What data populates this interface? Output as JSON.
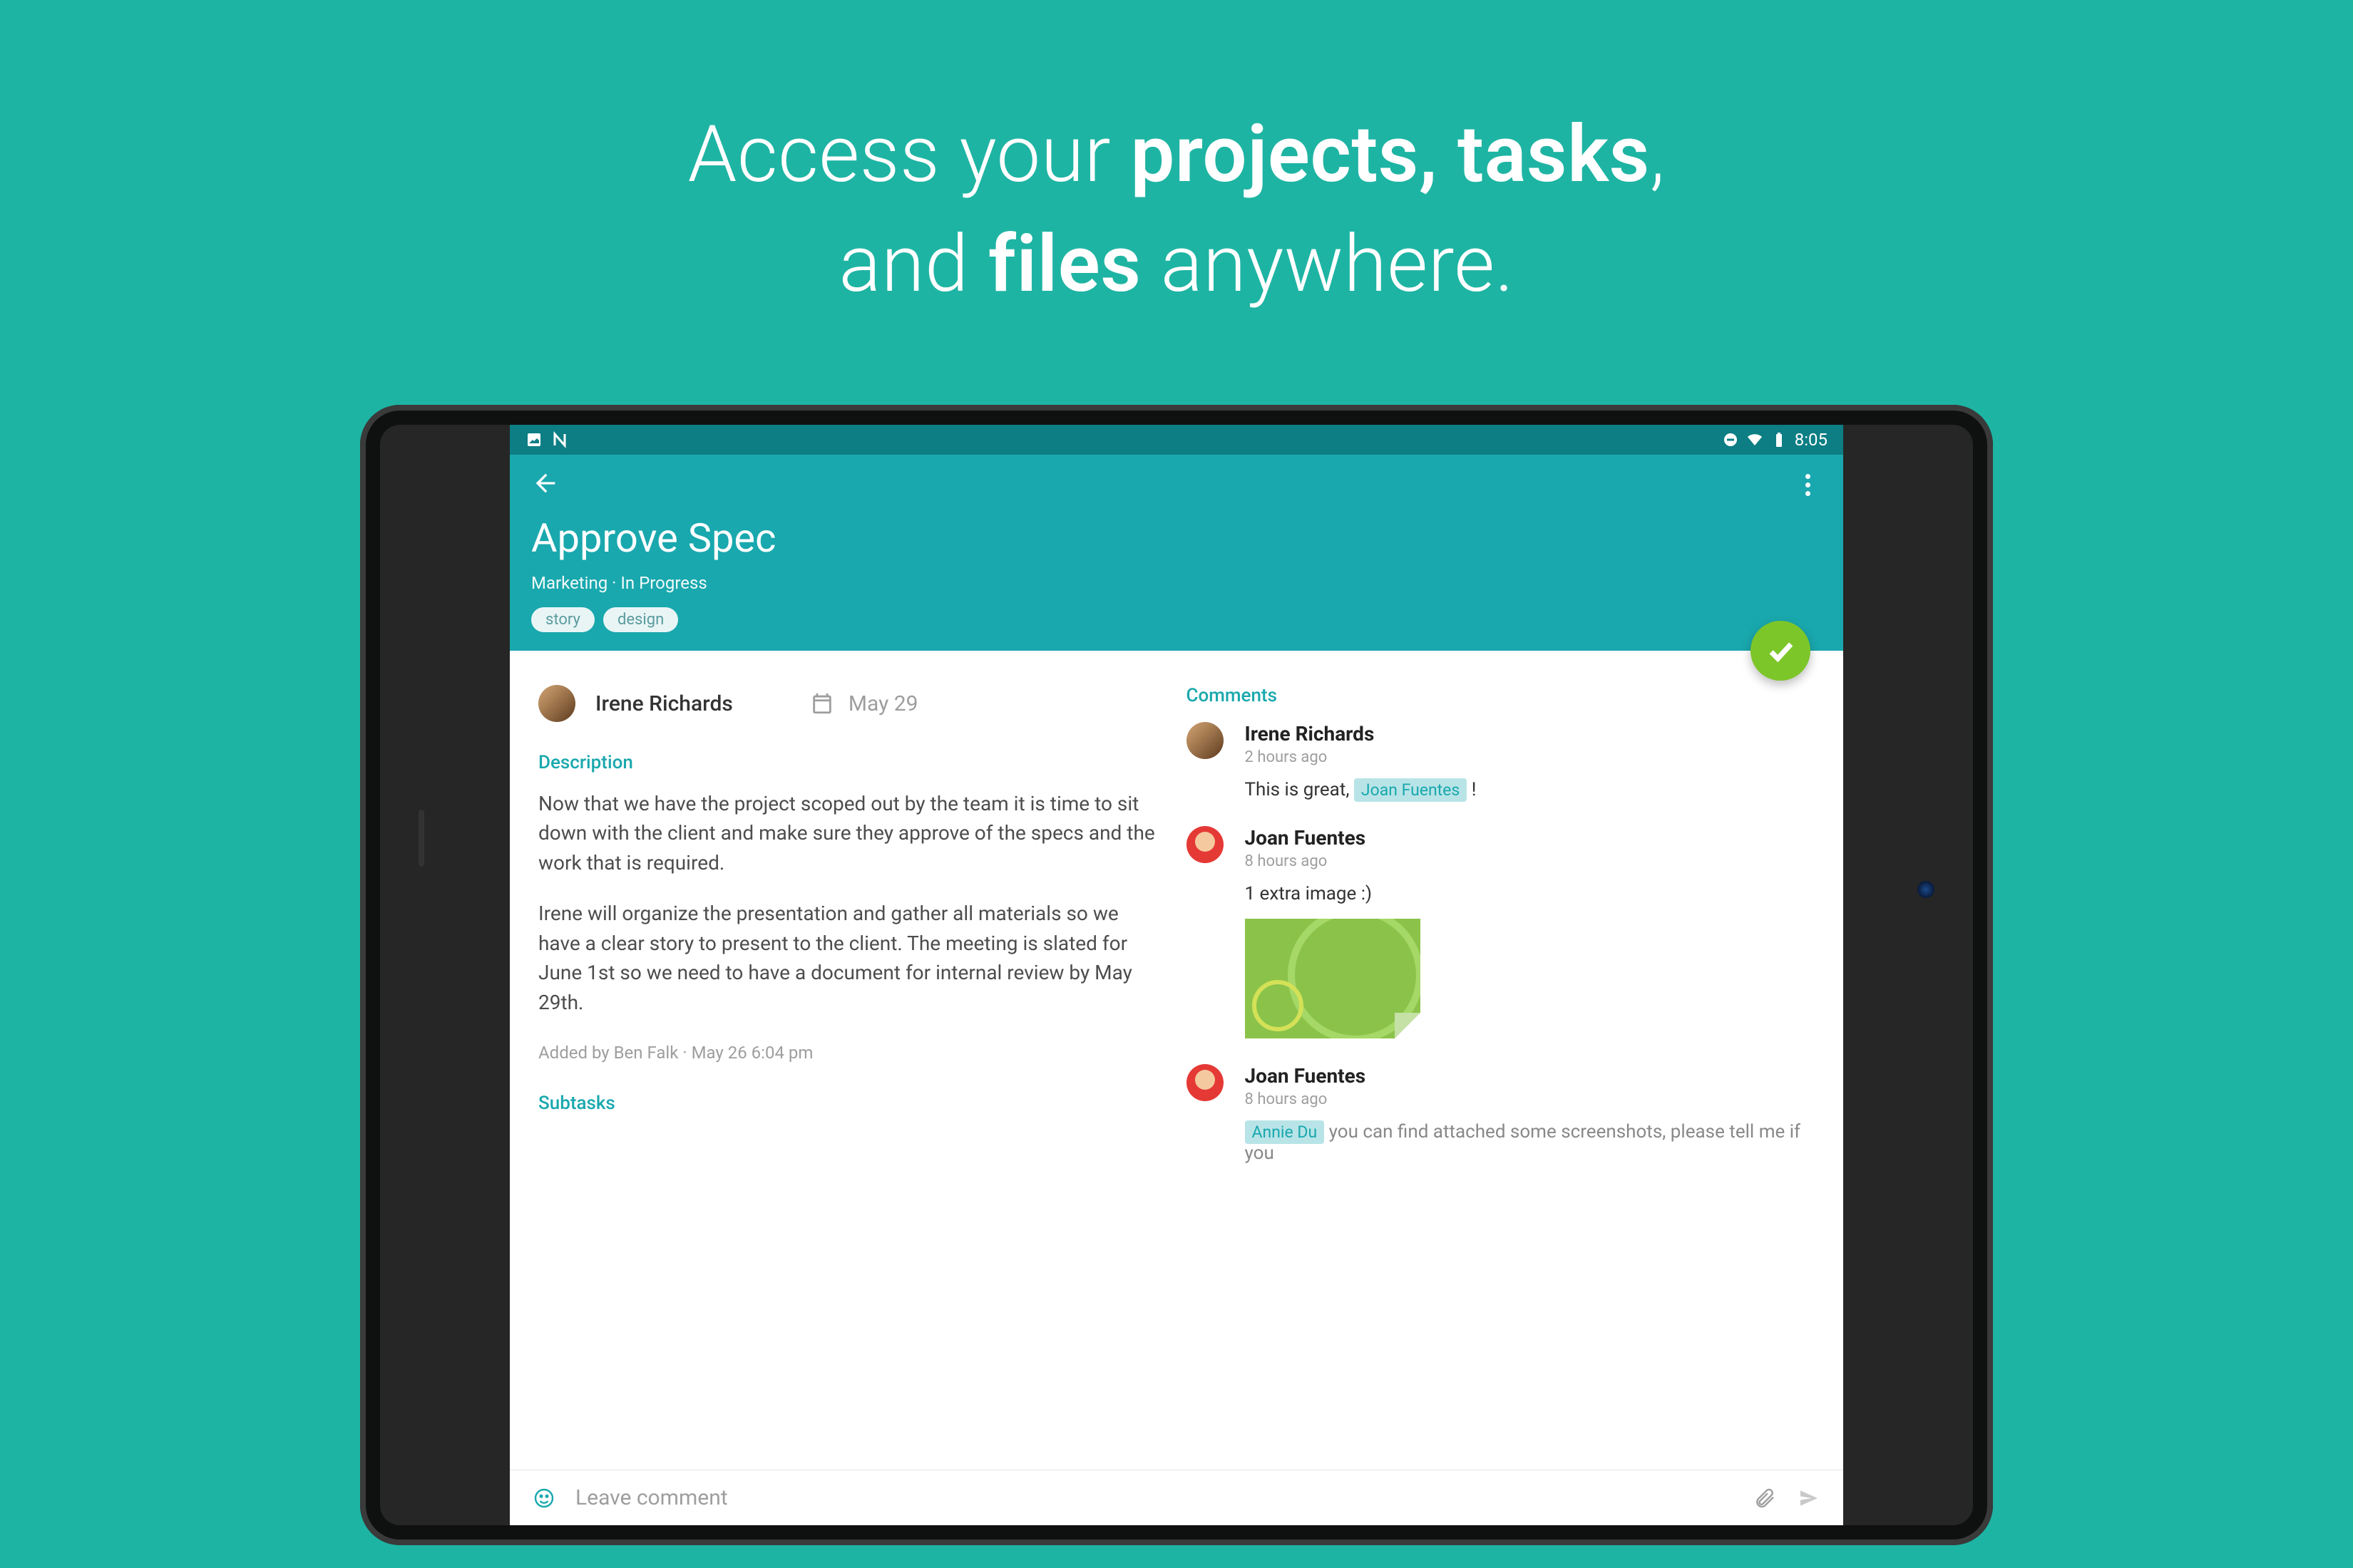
{
  "headline": {
    "pre1": "Access your ",
    "bold1": "projects, tasks",
    "post1": ",",
    "pre2": "and ",
    "bold2": "files",
    "post2": " anywhere."
  },
  "statusbar": {
    "time": "8:05"
  },
  "task": {
    "title": "Approve Spec",
    "subtitle": "Marketing · In Progress",
    "tags": [
      "story",
      "design"
    ]
  },
  "assignee": {
    "name": "Irene Richards",
    "due": "May 29"
  },
  "labels": {
    "description": "Description",
    "subtasks": "Subtasks",
    "comments": "Comments"
  },
  "description": {
    "p1": "Now that we have the project scoped out by the team it is time to sit down with the client and make sure they approve of the specs and the work that is required.",
    "p2": "Irene will organize the presentation and gather all materials so we have a clear story to present to the client. The meeting is slated for June 1st so we need to have a document for internal review by May 29th."
  },
  "added_by": "Added by Ben Falk · May 26 6:04 pm",
  "comments": [
    {
      "author": "Irene Richards",
      "time": "2 hours ago",
      "text_pre": "This is great, ",
      "mention": "Joan Fuentes",
      "text_post": " !",
      "avatar": "irene"
    },
    {
      "author": "Joan Fuentes",
      "time": "8 hours ago",
      "text": "1 extra image :)",
      "has_image": true,
      "avatar": "joan"
    },
    {
      "author": "Joan Fuentes",
      "time": "8 hours ago",
      "mention2": "Annie Du",
      "truncated": "you can find attached some screenshots, please tell me if you",
      "avatar": "joan"
    }
  ],
  "composer": {
    "placeholder": "Leave comment"
  }
}
